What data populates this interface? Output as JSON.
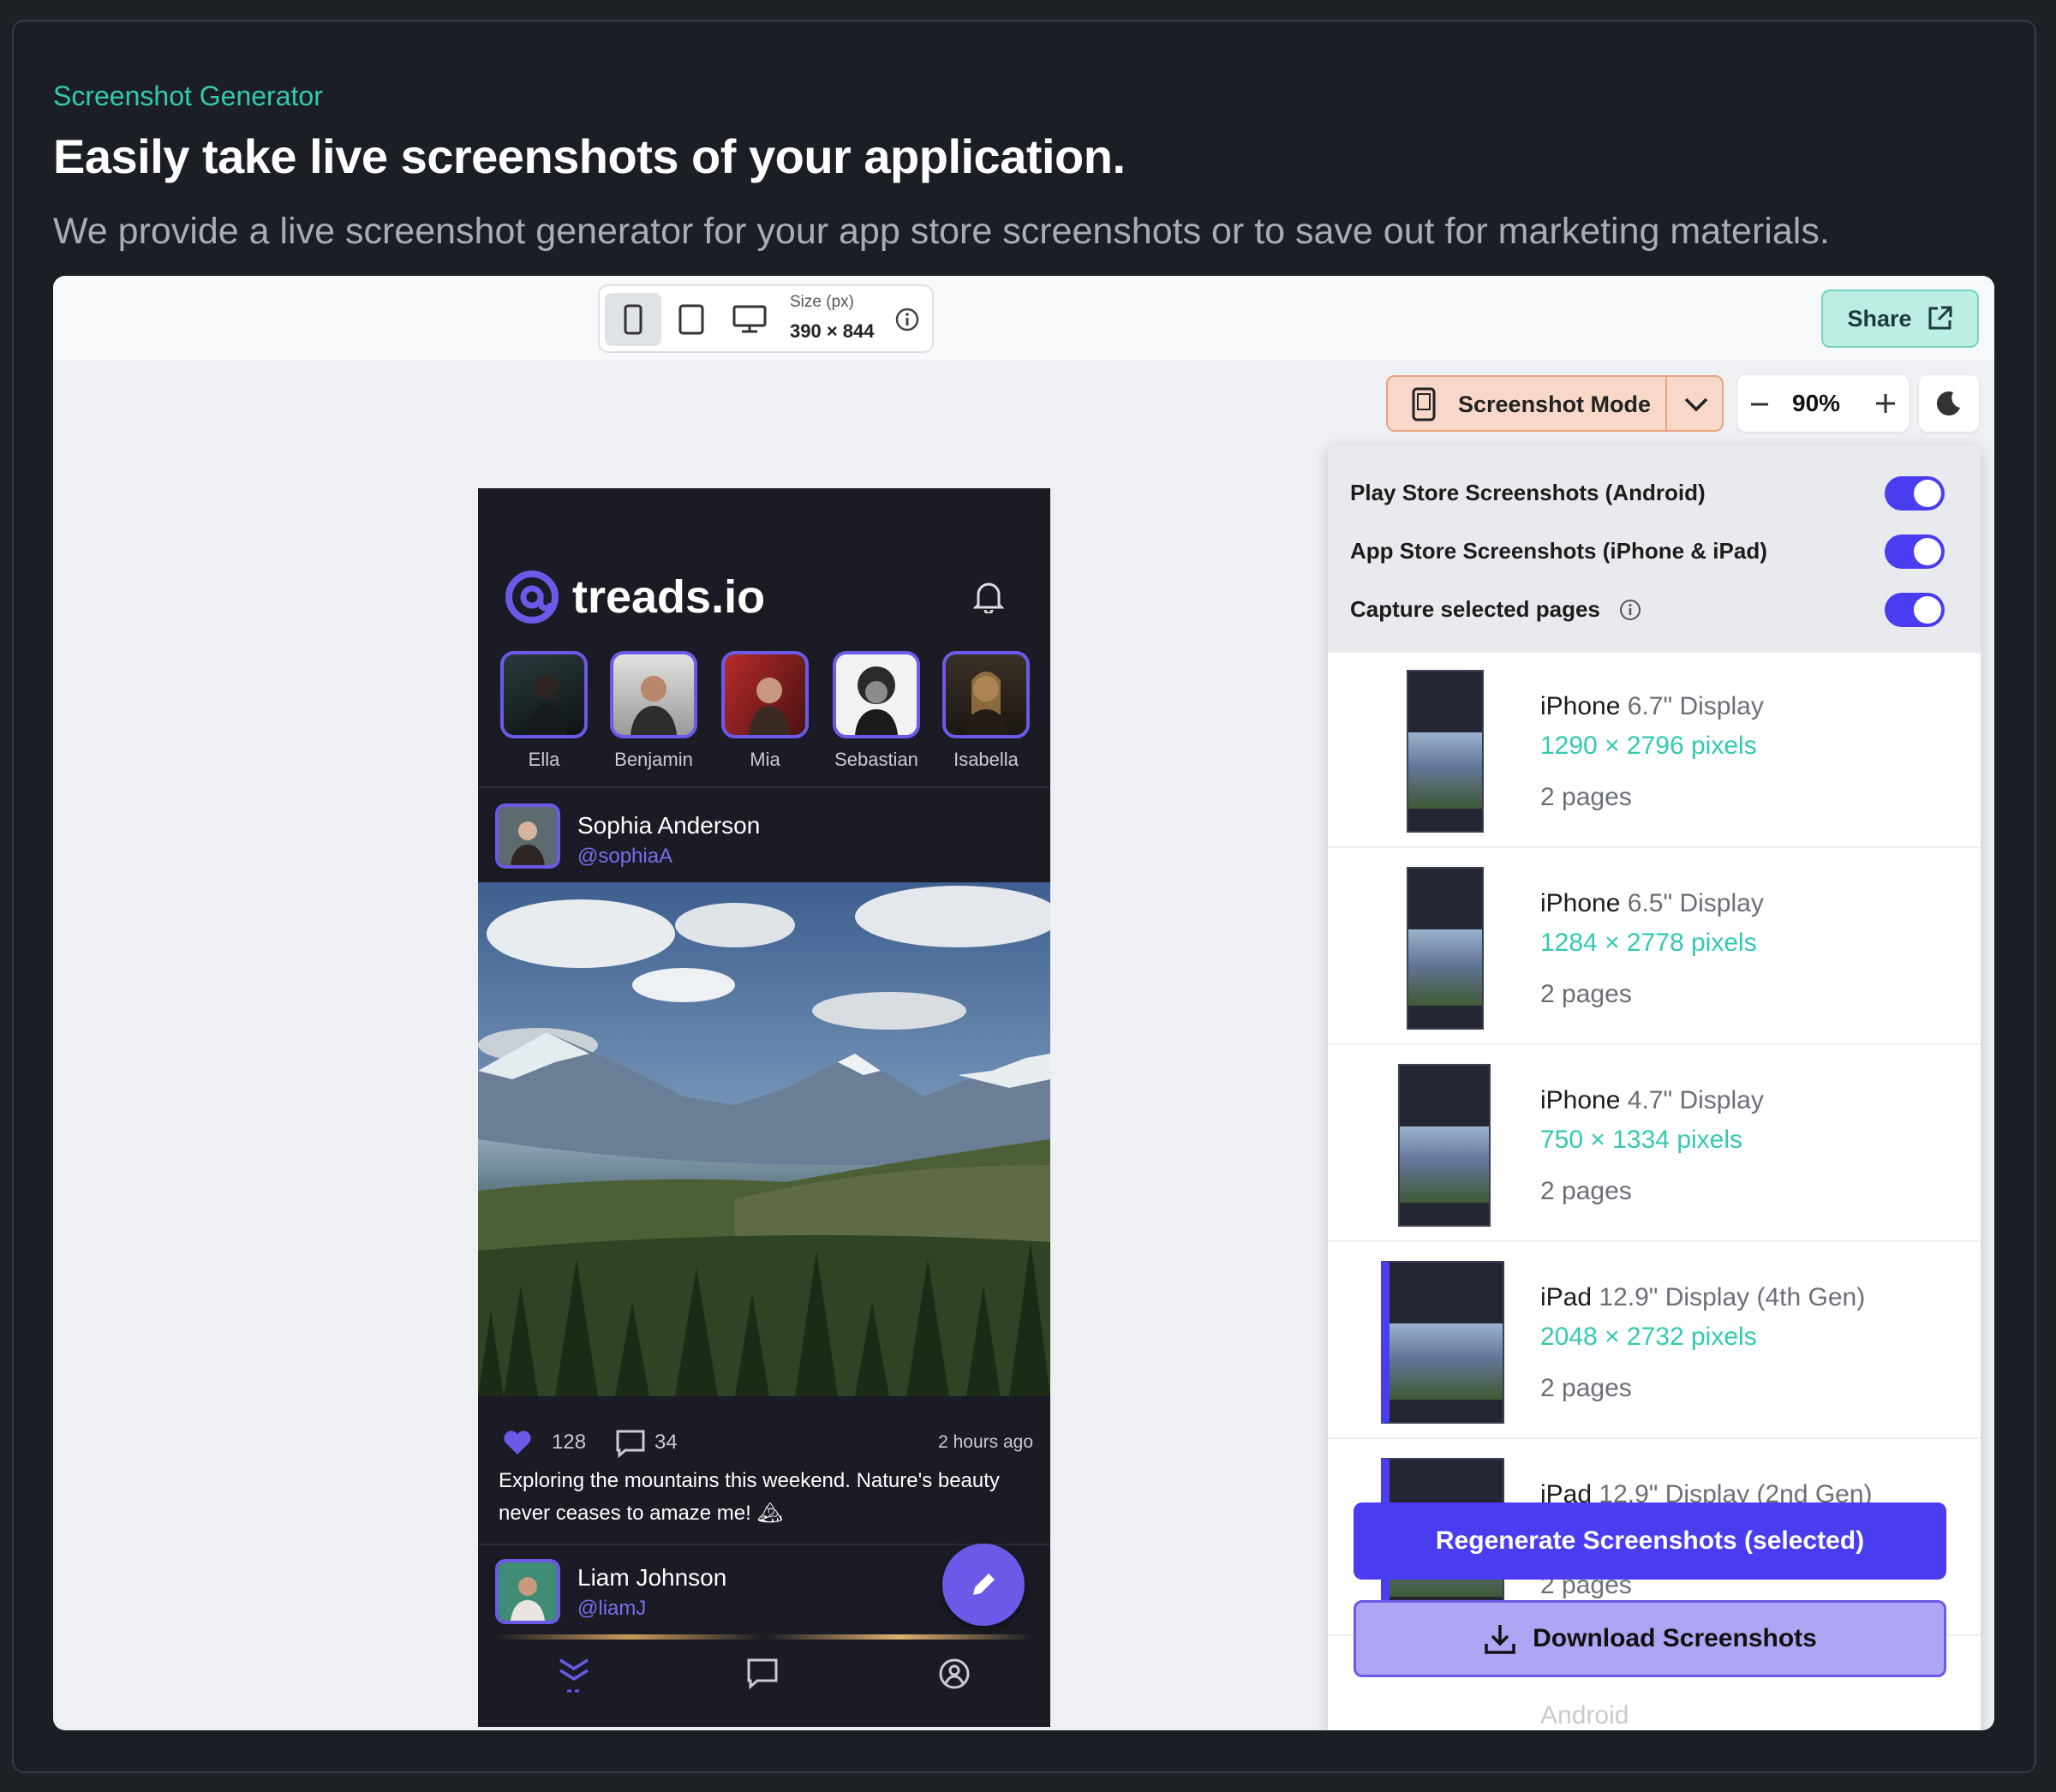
{
  "section": {
    "eyebrow": "Screenshot Generator",
    "headline": "Easily take live screenshots of your application.",
    "subline": "We provide a live screenshot generator for your app store screenshots or to save out for marketing materials."
  },
  "toolbar": {
    "size_caption": "Size (px)",
    "size_value": "390 × 844",
    "share_label": "Share",
    "mode_label": "Screenshot Mode",
    "zoom_value": "90%",
    "icons": [
      "phone-icon",
      "tablet-icon",
      "desktop-icon",
      "info-icon",
      "external-link-icon",
      "chevron-down-icon",
      "minus-icon",
      "plus-icon",
      "moon-icon"
    ]
  },
  "app": {
    "brand": "treads.io",
    "stories": [
      "Ella",
      "Benjamin",
      "Mia",
      "Sebastian",
      "Isabella"
    ],
    "post1": {
      "name": "Sophia Anderson",
      "handle": "@sophiaA",
      "likes": "128",
      "comments": "34",
      "time": "2 hours ago",
      "caption": "Exploring the mountains this weekend. Nature's beauty never ceases to amaze me! 🏔"
    },
    "post2": {
      "name": "Liam Johnson",
      "handle": "@liamJ"
    }
  },
  "panel": {
    "toggles": [
      {
        "label": "Play Store Screenshots (Android)",
        "on": true
      },
      {
        "label": "App Store Screenshots (iPhone & iPad)",
        "on": true
      },
      {
        "label": "Capture selected pages",
        "on": true
      }
    ],
    "devices": [
      {
        "name": "iPhone",
        "display": "6.7\" Display",
        "pixels": "1290 × 2796 pixels",
        "pages": "2 pages"
      },
      {
        "name": "iPhone",
        "display": "6.5\" Display",
        "pixels": "1284 × 2778 pixels",
        "pages": "2 pages"
      },
      {
        "name": "iPhone",
        "display": "4.7\" Display",
        "pixels": "750 × 1334 pixels",
        "pages": "2 pages"
      },
      {
        "name": "iPad",
        "display": "12.9\" Display (4th Gen)",
        "pixels": "2048 × 2732 pixels",
        "pages": "2 pages"
      },
      {
        "name": "iPad",
        "display": "12.9\" Display (2nd Gen)",
        "pixels": "",
        "pages": "2 pages"
      }
    ],
    "regenerate_label": "Regenerate Screenshots (selected)",
    "download_label": "Download Screenshots",
    "next_group": "Android"
  },
  "colors": {
    "accent": "#4a3df0",
    "teal": "#33c9b0",
    "app_bg": "#1a1b24"
  }
}
